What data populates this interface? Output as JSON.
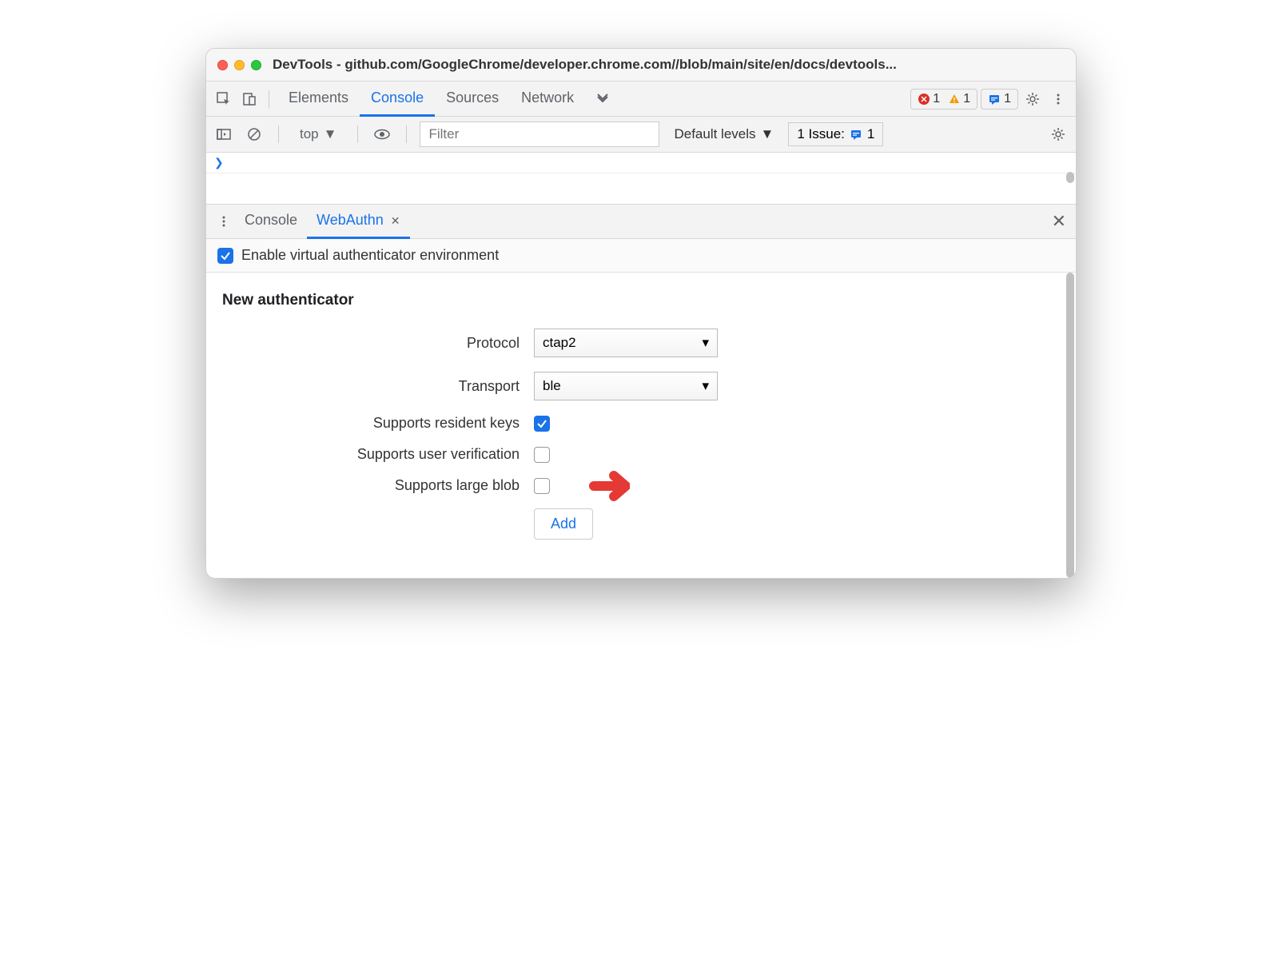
{
  "window": {
    "title": "DevTools - github.com/GoogleChrome/developer.chrome.com//blob/main/site/en/docs/devtools..."
  },
  "topbar": {
    "tabs": [
      "Elements",
      "Console",
      "Sources",
      "Network"
    ],
    "active_tab": "Console",
    "error_count": "1",
    "warning_count": "1",
    "issue_count": "1"
  },
  "consolebar": {
    "context": "top",
    "filter_placeholder": "Filter",
    "levels": "Default levels",
    "issues_label": "1 Issue:",
    "issues_count": "1"
  },
  "drawer": {
    "tabs": [
      "Console",
      "WebAuthn"
    ],
    "active_tab": "WebAuthn"
  },
  "webauthn": {
    "enable_label": "Enable virtual authenticator environment",
    "enable_checked": true,
    "section_title": "New authenticator",
    "rows": {
      "protocol_label": "Protocol",
      "protocol_value": "ctap2",
      "transport_label": "Transport",
      "transport_value": "ble",
      "resident_keys_label": "Supports resident keys",
      "resident_keys_checked": true,
      "user_verification_label": "Supports user verification",
      "user_verification_checked": false,
      "large_blob_label": "Supports large blob",
      "large_blob_checked": false
    },
    "add_button": "Add"
  }
}
